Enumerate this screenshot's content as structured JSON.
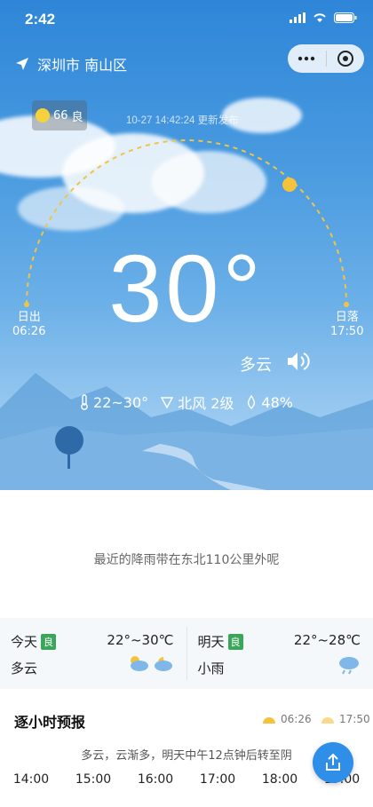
{
  "status_bar": {
    "time": "2:42"
  },
  "header": {
    "location": "深圳市 南山区"
  },
  "aqi": {
    "value": "66",
    "level": "良"
  },
  "update_text": "10-27 14:42:24 更新发布",
  "sun": {
    "sunrise_label": "日出",
    "sunrise_time": "06:26",
    "sunset_label": "日落",
    "sunset_time": "17:50"
  },
  "current": {
    "temperature": "30°",
    "condition": "多云",
    "range": "22~30°",
    "wind": "北风 2级",
    "humidity": "48%"
  },
  "rain_message": "最近的降雨带在东北110公里外呢",
  "forecast": [
    {
      "day": "今天",
      "aqi": "良",
      "range": "22°~30℃",
      "condition": "多云"
    },
    {
      "day": "明天",
      "aqi": "良",
      "range": "22°~28℃",
      "condition": "小雨"
    }
  ],
  "hourly": {
    "title": "逐小时预报",
    "sunrise": "06:26",
    "sunset": "17:50",
    "summary": "多云，云渐多，明天中午12点钟后转至阴",
    "hours": [
      "14:00",
      "15:00",
      "16:00",
      "17:00",
      "18:00",
      "19:00"
    ]
  },
  "colors": {
    "sky_top": "#2f86d8",
    "sun": "#f5c23c",
    "aqi_good": "#3aa65a",
    "share_button": "#2e8ee8"
  }
}
